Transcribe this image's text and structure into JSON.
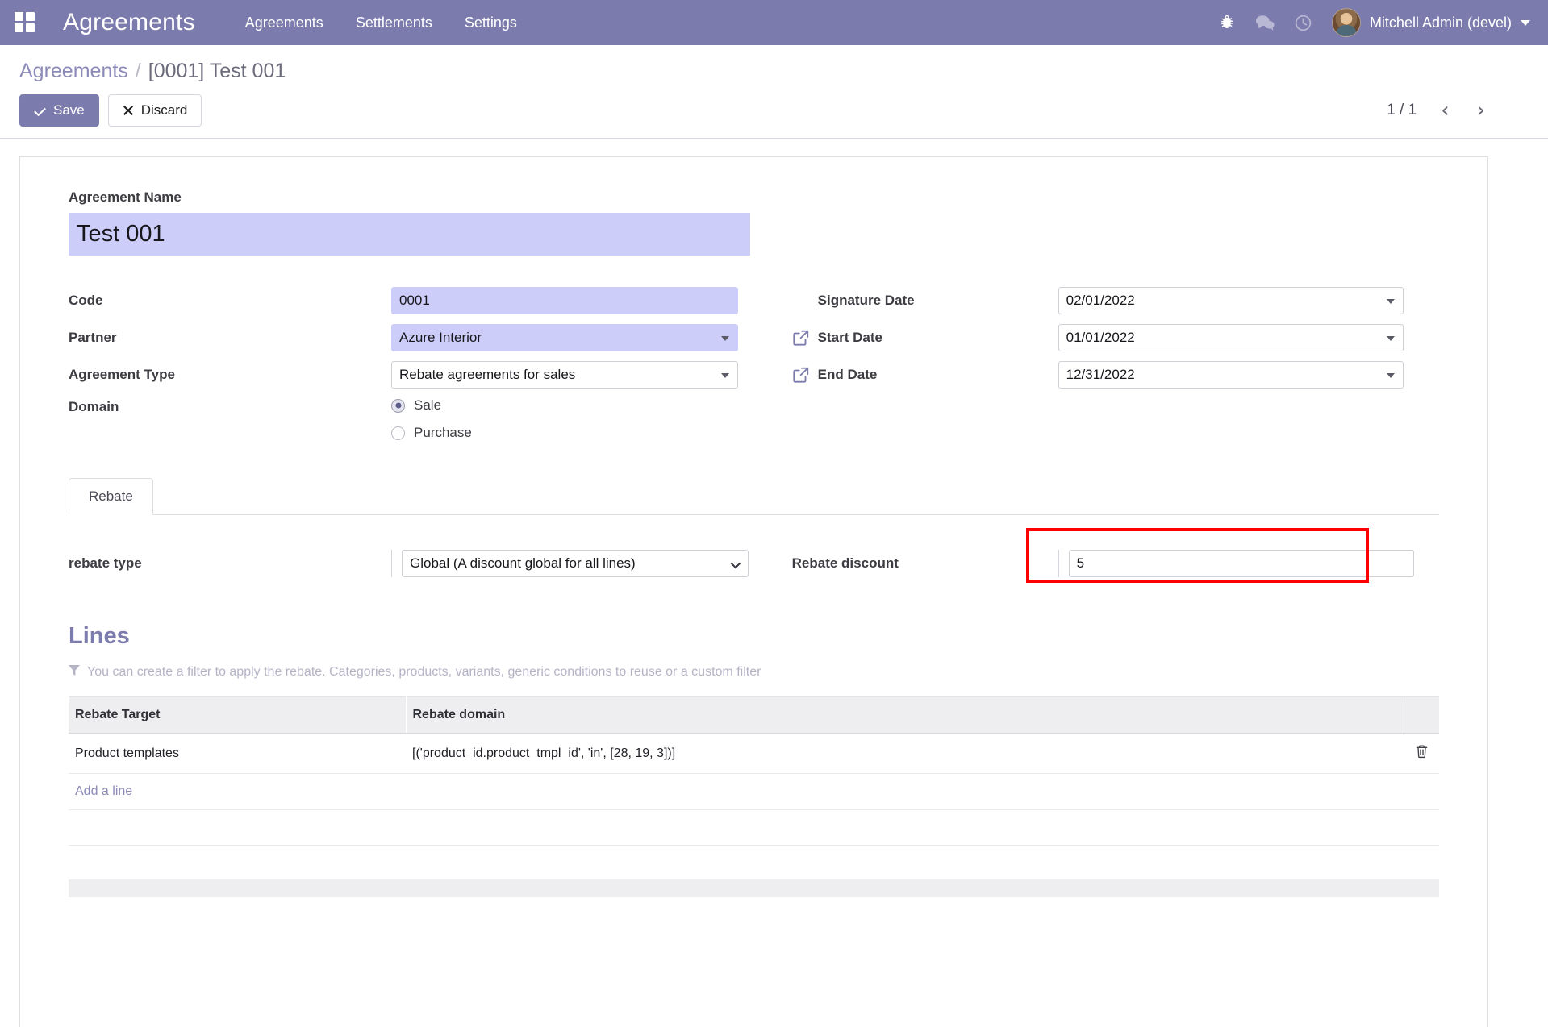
{
  "navbar": {
    "apps_icon": "apps-grid-icon",
    "brand": "Agreements",
    "menu": [
      {
        "label": "Agreements"
      },
      {
        "label": "Settlements"
      },
      {
        "label": "Settings"
      }
    ],
    "icons": [
      {
        "name": "bug-icon"
      },
      {
        "name": "messages-icon"
      },
      {
        "name": "activity-clock-icon"
      }
    ],
    "user": {
      "name": "Mitchell Admin (devel)",
      "avatar": "user-avatar"
    },
    "accent_color": "#7c7bad"
  },
  "control_panel": {
    "breadcrumb": {
      "root": "Agreements",
      "separator": "/",
      "current": "[0001] Test 001"
    },
    "save_label": "Save",
    "discard_label": "Discard",
    "pager": {
      "count": "1 / 1",
      "prev": "‹",
      "next": "›"
    }
  },
  "form": {
    "title": {
      "label": "Agreement Name",
      "value": "Test 001"
    },
    "left_fields": [
      {
        "label": "Code",
        "value": "0001",
        "type": "text",
        "required": true
      },
      {
        "label": "Partner",
        "value": "Azure Interior",
        "type": "select",
        "required": true
      },
      {
        "label": "Agreement Type",
        "value": "Rebate agreements for sales",
        "type": "select",
        "required": false
      }
    ],
    "domain": {
      "label": "Domain",
      "options": [
        {
          "label": "Sale",
          "selected": true
        },
        {
          "label": "Purchase",
          "selected": false
        }
      ]
    },
    "right_fields": [
      {
        "label": "Signature Date",
        "value": "02/01/2022",
        "has_link_icon": false
      },
      {
        "label": "Start Date",
        "value": "01/01/2022",
        "has_link_icon": true
      },
      {
        "label": "End Date",
        "value": "12/31/2022",
        "has_link_icon": true
      }
    ]
  },
  "notebook": {
    "tabs": [
      {
        "label": "Rebate",
        "active": true
      }
    ],
    "rebate_type": {
      "label": "rebate type",
      "value": "Global (A discount global for all lines)"
    },
    "rebate_discount": {
      "label": "Rebate discount",
      "value": "5",
      "highlight_color": "#ff0000"
    }
  },
  "lines": {
    "title": "Lines",
    "hint": "You can create a filter to apply the rebate. Categories, products, variants, generic conditions to reuse or a custom filter",
    "columns": [
      "Rebate Target",
      "Rebate domain",
      ""
    ],
    "rows": [
      {
        "target": "Product templates",
        "domain": "[('product_id.product_tmpl_id', 'in', [28, 19, 3])]",
        "delete_icon": "trash-icon"
      }
    ],
    "add_line_label": "Add a line"
  }
}
